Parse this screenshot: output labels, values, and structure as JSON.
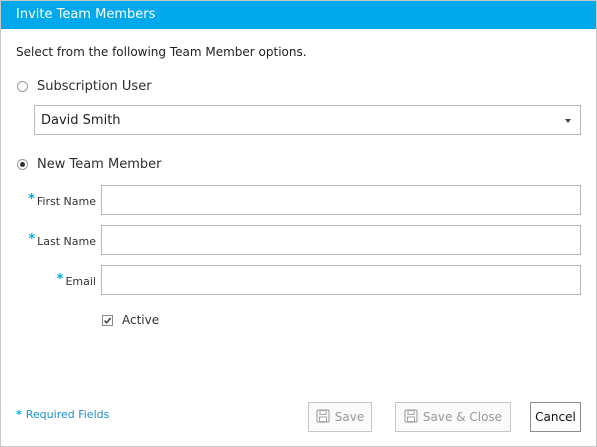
{
  "dialog": {
    "title": "Invite Team Members",
    "instructions": "Select from the following Team Member options."
  },
  "options": {
    "subscription_user": {
      "label": "Subscription User",
      "selected": false
    },
    "new_team_member": {
      "label": "New Team Member",
      "selected": true
    }
  },
  "user_select": {
    "value": "David Smith"
  },
  "form": {
    "first_name_label": "First Name",
    "last_name_label": "Last Name",
    "email_label": "Email",
    "required_marker": "*",
    "first_name_value": "",
    "last_name_value": "",
    "email_value": "",
    "active_label": "Active",
    "active_checked": true
  },
  "footer": {
    "required_note": "Required Fields",
    "save_label": "Save",
    "save_close_label": "Save & Close",
    "cancel_label": "Cancel"
  },
  "colors": {
    "titlebar": "#01a9ea",
    "required": "#01a9ea",
    "link": "#1a8fd0"
  },
  "icons": {
    "save": "floppy-disk-icon",
    "select_caret": "caret-down-icon",
    "checkbox_check": "checkmark-icon"
  }
}
